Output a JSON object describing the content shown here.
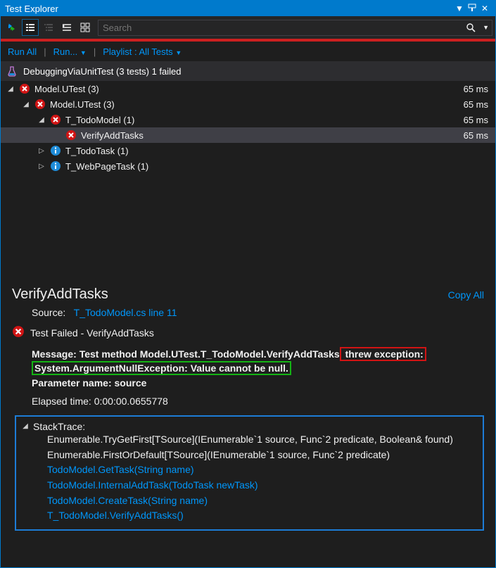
{
  "window": {
    "title": "Test Explorer"
  },
  "search": {
    "placeholder": "Search"
  },
  "linkbar": {
    "run_all": "Run All",
    "run": "Run...",
    "playlist": "Playlist : All Tests"
  },
  "summary": {
    "text": "DebuggingViaUnitTest (3 tests) 1 failed"
  },
  "tree": [
    {
      "level": 0,
      "expand": "open",
      "status": "fail",
      "label": "Model.UTest (3)",
      "time": "65 ms"
    },
    {
      "level": 1,
      "expand": "open",
      "status": "fail",
      "label": "Model.UTest (3)",
      "time": "65 ms"
    },
    {
      "level": 2,
      "expand": "open",
      "status": "fail",
      "label": "T_TodoModel (1)",
      "time": "65 ms"
    },
    {
      "level": 3,
      "expand": "none",
      "status": "fail",
      "label": "VerifyAddTasks",
      "time": "65 ms",
      "selected": true
    },
    {
      "level": 2,
      "expand": "closed",
      "status": "info",
      "label": "T_TodoTask (1)",
      "time": ""
    },
    {
      "level": 2,
      "expand": "closed",
      "status": "info",
      "label": "T_WebPageTask (1)",
      "time": ""
    }
  ],
  "details": {
    "title": "VerifyAddTasks",
    "copy_all": "Copy All",
    "source_label": "Source:",
    "source_link": "T_TodoModel.cs line 11",
    "fail_caption": "Test Failed - VerifyAddTasks",
    "message_prefix": "Message: Test method Model.UTest.T_TodoModel.VerifyAddTasks",
    "threw": " threw exception: ",
    "exception_line": "System.ArgumentNullException: Value cannot be null.",
    "param_line": "Parameter name: source",
    "elapsed": "Elapsed time: 0:00:00.0655778",
    "stack_label": "StackTrace:",
    "stack": [
      {
        "text": "Enumerable.TryGetFirst[TSource](IEnumerable`1 source, Func`2 predicate, Boolean& found)",
        "link": false
      },
      {
        "text": "Enumerable.FirstOrDefault[TSource](IEnumerable`1 source, Func`2 predicate)",
        "link": false
      },
      {
        "text": "TodoModel.GetTask(String name)",
        "link": true
      },
      {
        "text": "TodoModel.InternalAddTask(TodoTask newTask)",
        "link": true
      },
      {
        "text": "TodoModel.CreateTask(String name)",
        "link": true
      },
      {
        "text": "T_TodoModel.VerifyAddTasks()",
        "link": true
      }
    ]
  }
}
